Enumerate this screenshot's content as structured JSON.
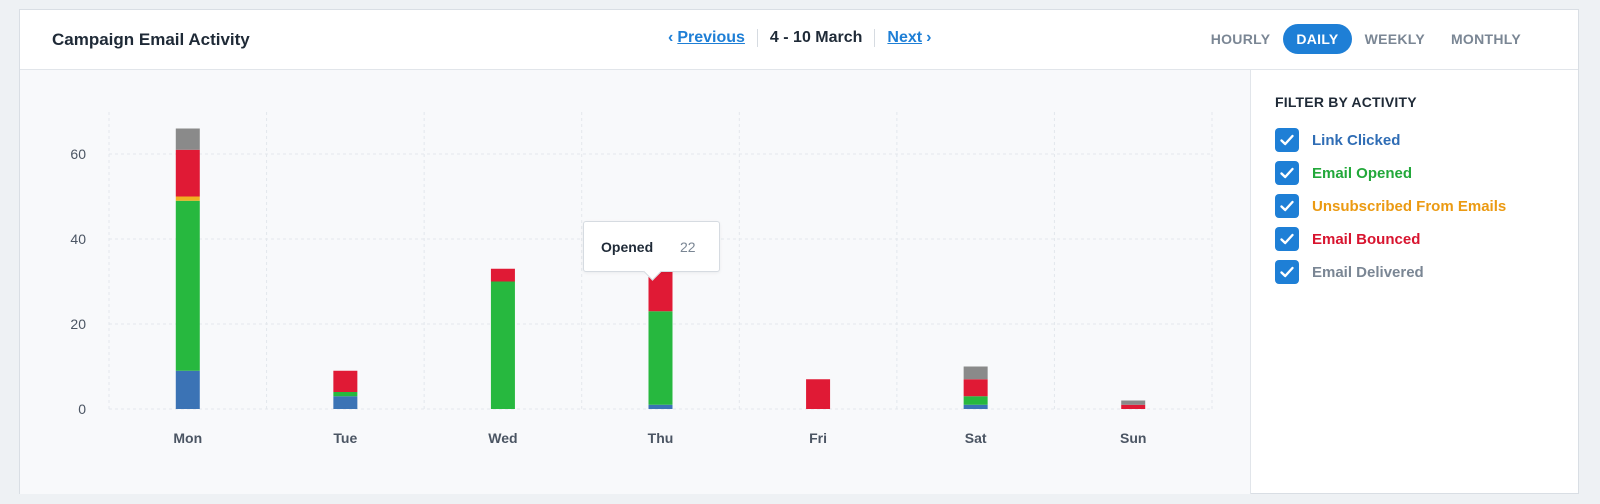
{
  "header": {
    "title": "Campaign Email Activity",
    "previous_label": "Previous",
    "date_range": "4 - 10 March",
    "next_label": "Next",
    "periods": [
      "HOURLY",
      "DAILY",
      "WEEKLY",
      "MONTHLY"
    ],
    "active_period": "DAILY"
  },
  "filters": {
    "heading": "FILTER BY ACTIVITY",
    "items": [
      {
        "label": "Link Clicked",
        "color": "#2f6db5",
        "checked": true
      },
      {
        "label": "Email Opened",
        "color": "#22a83a",
        "checked": true
      },
      {
        "label": "Unsubscribed From Emails",
        "color": "#eb9a12",
        "checked": true
      },
      {
        "label": "Email Bounced",
        "color": "#d8142f",
        "checked": true
      },
      {
        "label": "Email Delivered",
        "color": "#7a8694",
        "checked": true
      }
    ]
  },
  "tooltip": {
    "label": "Opened",
    "value": "22"
  },
  "chart_data": {
    "type": "bar",
    "stacked": true,
    "categories": [
      "Mon",
      "Tue",
      "Wed",
      "Thu",
      "Fri",
      "Sat",
      "Sun"
    ],
    "series": [
      {
        "name": "Link Clicked",
        "color": "#3b73b5",
        "values": [
          9,
          3,
          0,
          1,
          0,
          1,
          0
        ]
      },
      {
        "name": "Email Opened",
        "color": "#27b83f",
        "values": [
          40,
          1,
          30,
          22,
          0,
          2,
          0
        ]
      },
      {
        "name": "Unsubscribed From Emails",
        "color": "#f0b020",
        "values": [
          1,
          0,
          0,
          0,
          0,
          0,
          0
        ]
      },
      {
        "name": "Email Bounced",
        "color": "#e01a35",
        "values": [
          11,
          5,
          3,
          19,
          7,
          4,
          1
        ]
      },
      {
        "name": "Email Delivered",
        "color": "#8a8a8a",
        "values": [
          5,
          0,
          0,
          0,
          0,
          3,
          1
        ]
      }
    ],
    "ylim": [
      0,
      65
    ],
    "yticks": [
      0,
      20,
      40,
      60
    ],
    "grid": true
  }
}
